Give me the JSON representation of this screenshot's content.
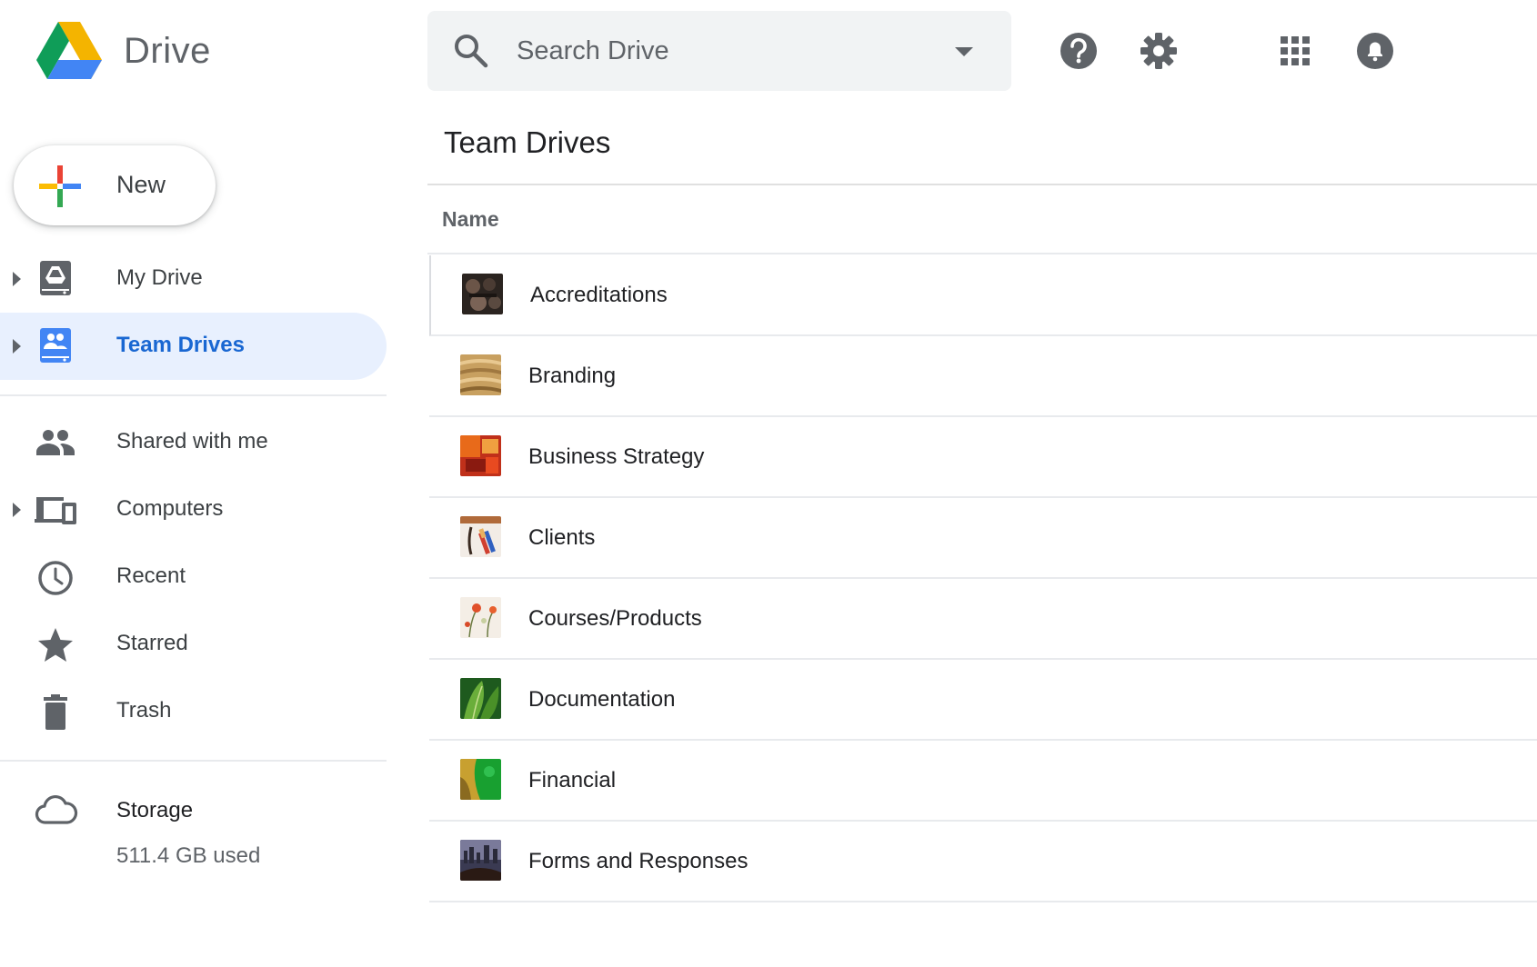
{
  "app": {
    "title": "Drive",
    "logo_icon": "google-drive-logo"
  },
  "search": {
    "placeholder": "Search Drive",
    "value": "",
    "icon": "search-icon",
    "dropdown_icon": "caret-down-icon"
  },
  "header_icons": [
    "help-icon",
    "settings-icon",
    "apps-grid-icon",
    "notifications-bell-icon"
  ],
  "sidebar": {
    "new_label": "New",
    "items": [
      {
        "label": "My Drive",
        "icon": "my-drive-icon",
        "expandable": true,
        "active": false
      },
      {
        "label": "Team Drives",
        "icon": "team-drives-icon",
        "expandable": true,
        "active": true
      },
      {
        "label": "Shared with me",
        "icon": "people-icon",
        "expandable": false,
        "active": false
      },
      {
        "label": "Computers",
        "icon": "computers-icon",
        "expandable": true,
        "active": false
      },
      {
        "label": "Recent",
        "icon": "clock-icon",
        "expandable": false,
        "active": false
      },
      {
        "label": "Starred",
        "icon": "star-icon",
        "expandable": false,
        "active": false
      },
      {
        "label": "Trash",
        "icon": "trash-icon",
        "expandable": false,
        "active": false
      }
    ],
    "storage": {
      "label": "Storage",
      "used": "511.4 GB used",
      "icon": "cloud-icon"
    }
  },
  "main": {
    "title": "Team Drives",
    "column_header": "Name",
    "drives": [
      {
        "name": "Accreditations"
      },
      {
        "name": "Branding"
      },
      {
        "name": "Business Strategy"
      },
      {
        "name": "Clients"
      },
      {
        "name": "Courses/Products"
      },
      {
        "name": "Documentation"
      },
      {
        "name": "Financial"
      },
      {
        "name": "Forms and Responses"
      }
    ]
  },
  "colors": {
    "active_bg": "#e8f0fe",
    "active_text": "#1967d2",
    "icon_gray": "#5f6368",
    "drive_green": "#0f9d58",
    "drive_yellow": "#f4b400",
    "drive_blue": "#4285f4"
  }
}
